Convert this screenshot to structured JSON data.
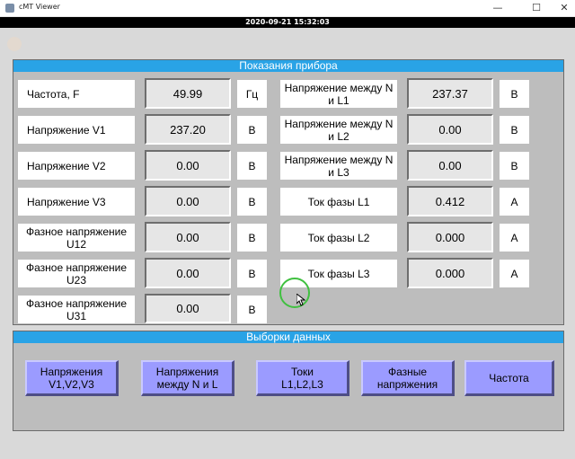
{
  "window": {
    "title": "cMT Viewer",
    "minimize": "—",
    "maximize": "☐",
    "close": "✕"
  },
  "datetime": "2020-09-21 15:32:03",
  "readings_panel": {
    "title": "Показания прибора",
    "left": [
      {
        "label": "Частота, F",
        "value": "49.99",
        "unit": "Гц"
      },
      {
        "label": "Напряжение V1",
        "value": "237.20",
        "unit": "В"
      },
      {
        "label": "Напряжение V2",
        "value": "0.00",
        "unit": "В"
      },
      {
        "label": "Напряжение V3",
        "value": "0.00",
        "unit": "В"
      },
      {
        "label": "Фазное напряжение U12",
        "value": "0.00",
        "unit": "В"
      },
      {
        "label": "Фазное напряжение U23",
        "value": "0.00",
        "unit": "В"
      },
      {
        "label": "Фазное напряжение U31",
        "value": "0.00",
        "unit": "В"
      }
    ],
    "right": [
      {
        "label": "Напряжение между N и L1",
        "value": "237.37",
        "unit": "В"
      },
      {
        "label": "Напряжение между N и L2",
        "value": "0.00",
        "unit": "В"
      },
      {
        "label": "Напряжение между N и L3",
        "value": "0.00",
        "unit": "В"
      },
      {
        "label": "Ток фазы L1",
        "value": "0.412",
        "unit": "A"
      },
      {
        "label": "Ток фазы L2",
        "value": "0.000",
        "unit": "A"
      },
      {
        "label": "Ток фазы L3",
        "value": "0.000",
        "unit": "A"
      }
    ]
  },
  "selection_panel": {
    "title": "Выборки данных",
    "buttons": [
      "Напряжения\nV1,V2,V3",
      "Напряжения\nмежду N и L",
      "Токи\nL1,L2,L3",
      "Фазные\nнапряжения",
      "Частота"
    ]
  },
  "colors": {
    "header_blue": "#29a3e6",
    "button_fill": "#9b9bff",
    "panel_gray": "#bdbdbd"
  }
}
